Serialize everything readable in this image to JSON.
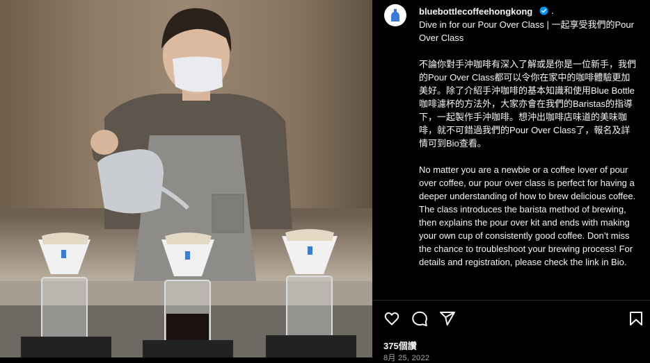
{
  "post": {
    "image_alt": "Barista pouring coffee over three pour-over drippers",
    "brand_logo_text": "BLUE BOTTLE"
  },
  "header": {
    "username": "bluebottlecoffeehongkong",
    "separator": "."
  },
  "caption": {
    "text": "Dive in for our Pour Over Class | 一起享受我們的Pour Over Class\n\n不論你對手沖咖啡有深入了解或是你是一位新手，我們的Pour Over Class都可以令你在家中的咖啡體驗更加美好。除了介紹手沖咖啡的基本知識和使用Blue Bottle咖啡濾杯的方法外，大家亦會在我們的Baristas的指導下，一起製作手沖咖啡。想沖出咖啡店味道的美味咖啡，就不可錯過我們的Pour Over Class了，報名及詳情可到Bio查看。\n\nNo matter you are a newbie or a coffee lover of pour over coffee, our pour over class is perfect for having a deeper understanding of how to brew delicious coffee. The class introduces the barista method of brewing, then explains the pour over kit and ends with making your own cup of consistently good coffee. Don’t miss the chance to troubleshoot your brewing process! For details and registration, please check the link in Bio."
  },
  "stats": {
    "likes": "375個讚",
    "date": "8月 25, 2022"
  },
  "icons": {
    "like": "heart-icon",
    "comment": "comment-icon",
    "share": "share-icon",
    "save": "bookmark-icon",
    "verified": "verified-badge-icon"
  },
  "colors": {
    "verified": "#0095f6",
    "brand_blue": "#3b7bd8"
  }
}
